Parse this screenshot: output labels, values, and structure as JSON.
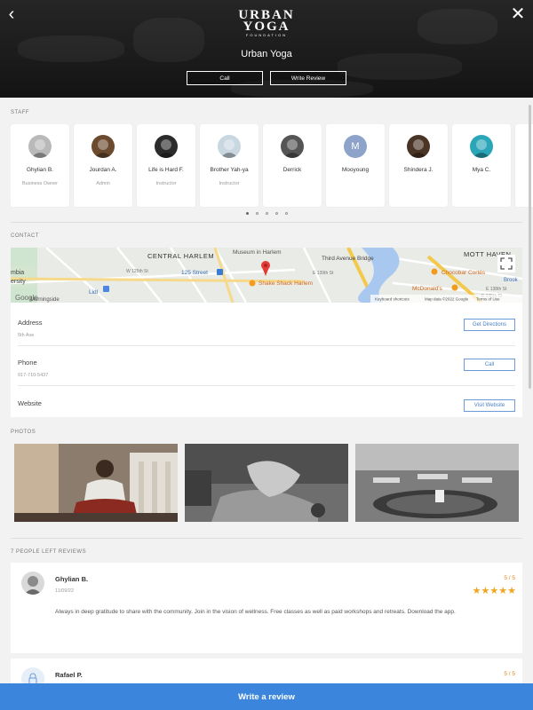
{
  "hero": {
    "logo_line1": "URBAN",
    "logo_line2": "YOGA",
    "logo_line3": "FOUNDATION",
    "title": "Urban Yoga",
    "call_label": "Call",
    "review_label": "Write Review"
  },
  "staff": {
    "section_label": "STAFF",
    "members": [
      {
        "name": "Ghylian B.",
        "role": "Business Owner",
        "avatar": "photo"
      },
      {
        "name": "Jourdan A.",
        "role": "Admin",
        "avatar": "photo"
      },
      {
        "name": "Life is Hard F.",
        "role": "Instructor",
        "avatar": "photo"
      },
      {
        "name": "Brother Yah-ya",
        "role": "Instructor",
        "avatar": "photo"
      },
      {
        "name": "Derrick",
        "role": "",
        "avatar": "photo"
      },
      {
        "name": "Mooyoung",
        "role": "",
        "avatar": "M"
      },
      {
        "name": "Shindera J.",
        "role": "",
        "avatar": "photo"
      },
      {
        "name": "Mya C.",
        "role": "",
        "avatar": "photo"
      }
    ],
    "page_count": 5,
    "active_page": 0
  },
  "contact": {
    "section_label": "CONTACT",
    "map": {
      "labels": {
        "central_harlem": "CENTRAL HARLEM",
        "museum": "Museum in Harlem",
        "third_ave": "Third Avenue Bridge",
        "mott_haven": "MOTT HAVEN",
        "chocobar": "Chocobar Cortés",
        "mcdonalds": "McDonald's",
        "shake_shack": "Shake Shack Harlem",
        "street_125": "125 Street",
        "w125": "W 125th St",
        "e139": "E 139th St",
        "e138": "E 138th St",
        "e135": "E 135th St",
        "broo": "Brook",
        "lidl": "Lidl",
        "morningside": "Morningside",
        "mbia": "mbia",
        "rsity": "ersity",
        "google": "Google",
        "keyboard": "Keyboard shortcuts",
        "map_data": "Map data ©2022 Google",
        "terms": "Terms of Use"
      }
    },
    "address": {
      "label": "Address",
      "value": "5th Ave",
      "button": "Get Directions"
    },
    "phone": {
      "label": "Phone",
      "value": "917-710-5437",
      "button": "Call"
    },
    "website": {
      "label": "Website",
      "button": "Visit Website"
    }
  },
  "photos": {
    "section_label": "PHOTOS"
  },
  "reviews": {
    "section_label": "7 PEOPLE LEFT REVIEWS",
    "items": [
      {
        "name": "Ghylian B.",
        "date": "11/09/22",
        "score": "5 / 5",
        "rating": 5,
        "text": "Always in deep gratitude to share with the community. Join in the vision of wellness. Free classes as well as paid workshops and retreats. Download the app."
      },
      {
        "name": "Rafael P.",
        "date": "",
        "score": "5 / 5",
        "rating": 5,
        "text": ""
      }
    ]
  },
  "bottom": {
    "write_review_label": "Write a review"
  },
  "colors": {
    "accent": "#3b86dc",
    "star": "#f0a51e",
    "score": "#e0831e"
  }
}
